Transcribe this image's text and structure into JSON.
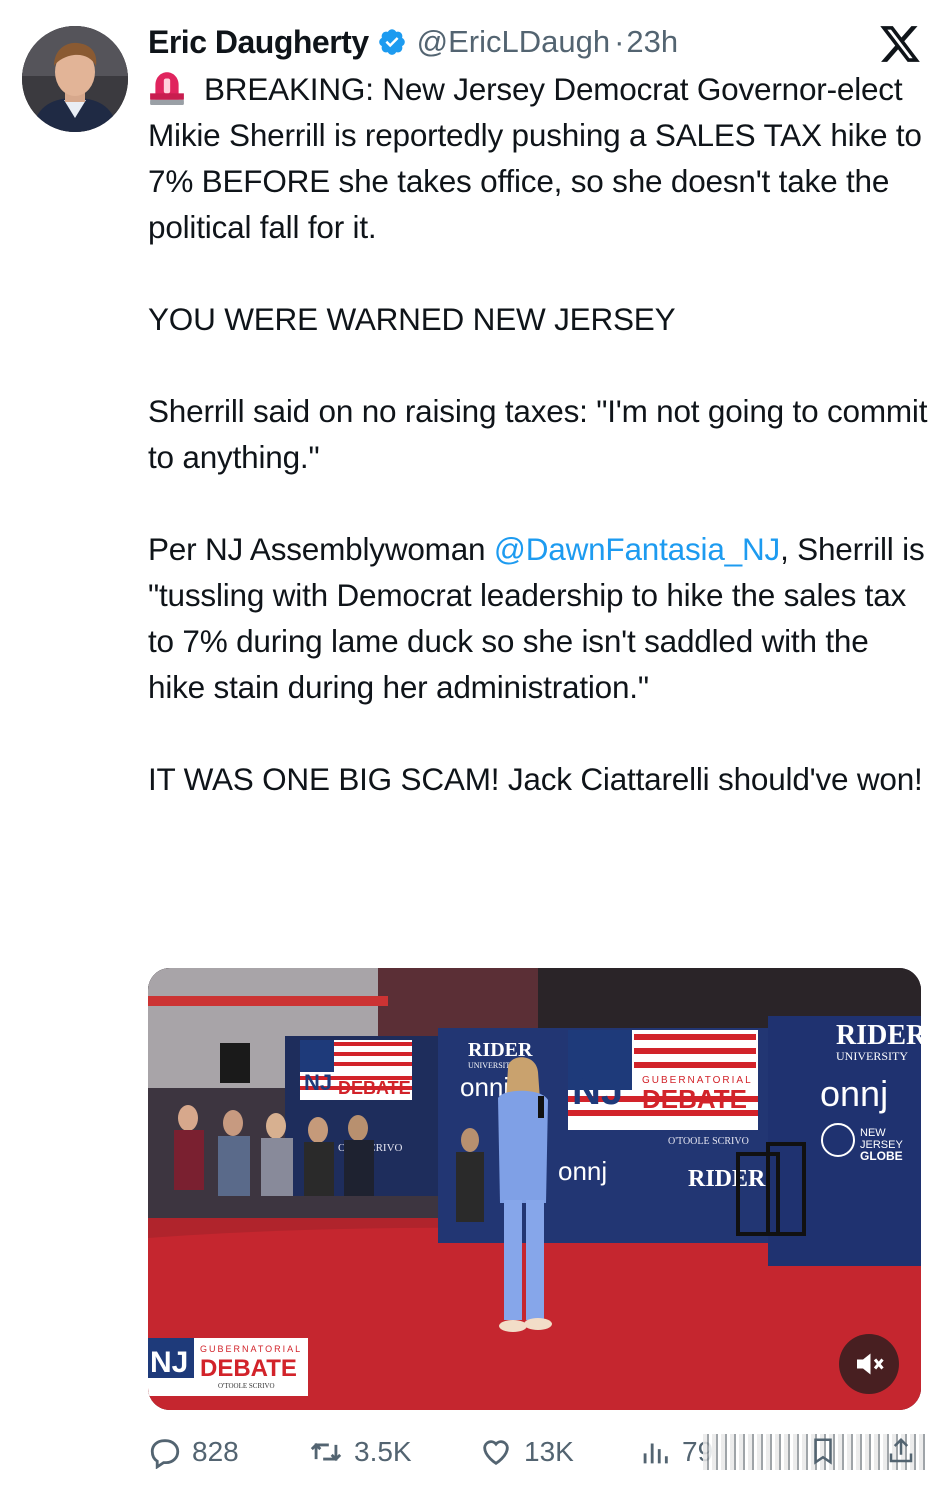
{
  "author": {
    "name": "Eric Daugherty",
    "handle": "@EricLDaugh",
    "separator": "·",
    "time": "23h"
  },
  "tweet": {
    "p1_text": "BREAKING: New Jersey Democrat Governor-elect Mikie Sherrill is reportedly pushing a SALES TAX hike to 7% BEFORE she takes office, so she doesn't take the political fall for it.",
    "p2": "YOU WERE WARNED NEW JERSEY",
    "p3": "Sherrill said on no raising taxes: \"I'm not going to commit to anything.\"",
    "p4_before": "Per NJ Assemblywoman ",
    "p4_mention": "@DawnFantasia_NJ",
    "p4_after": ", Sherrill is \"tussling with Democrat leadership to hike the sales tax to 7% during lame duck so she isn't saddled with the hike stain during her administration.\"",
    "p5": "IT WAS ONE BIG SCAM! Jack Ciattarelli should've won!"
  },
  "media": {
    "banner_nj": "NJ",
    "banner_debate": "DEBATE",
    "banner_gubernatorial": "GUBERNATORIAL",
    "sponsor_text": "O'TOOLE SCRIVO",
    "sponsor_left": "OLE SCRIVO",
    "rider": "RIDER",
    "rider_sub": "UNIVERSITY",
    "onnj": "onnj",
    "globe_new": "NEW",
    "globe_jersey": "JERSEY",
    "globe_globe": "GLOBE",
    "lower_nj": "NJ",
    "lower_gubernatorial": "GUBERNATORIAL",
    "lower_debate": "DEBATE",
    "lower_sponsor": "O'TOOLE SCRIVO",
    "corner_logo": "onnj"
  },
  "actions": {
    "replies": "828",
    "reposts": "3.5K",
    "likes": "13K",
    "views": "79"
  },
  "colors": {
    "link": "#1d9bf0",
    "muted": "#536471",
    "verified": "#1d9bf0",
    "alarm": "#e0245e"
  },
  "icons": [
    "verified-badge-icon",
    "x-logo-icon",
    "alarm-light-icon",
    "reply-icon",
    "repost-icon",
    "like-icon",
    "views-icon",
    "muted-speaker-icon",
    "bookmark-icon",
    "share-icon"
  ]
}
